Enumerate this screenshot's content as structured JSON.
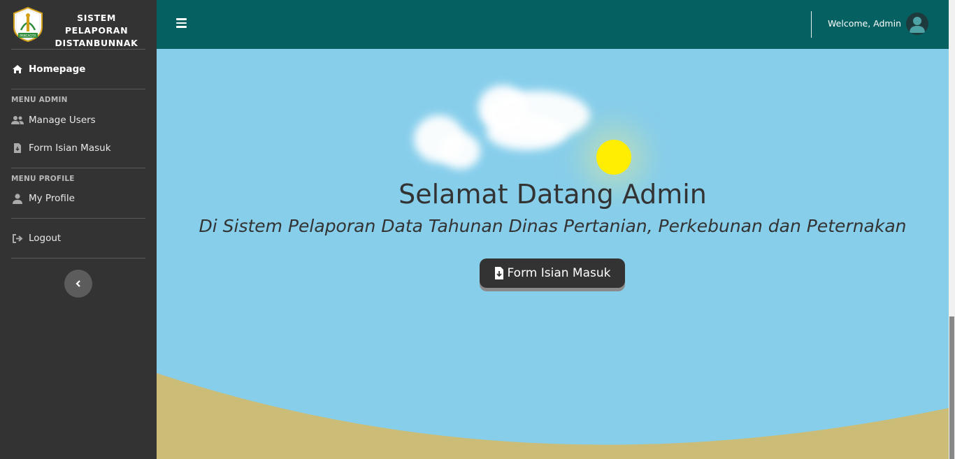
{
  "brand": {
    "line1": "SISTEM PELAPORAN",
    "line2": "DISTANBUNNAK",
    "logo_text": "PANCACITA"
  },
  "sidebar": {
    "homepage": "Homepage",
    "section_admin": "MENU ADMIN",
    "manage_users": "Manage Users",
    "form_isian": "Form Isian Masuk",
    "section_profile": "MENU PROFILE",
    "my_profile": "My Profile",
    "logout": "Logout",
    "icons": {
      "homepage": "home-icon",
      "manage_users": "users-icon",
      "form_isian": "file-download-icon",
      "my_profile": "user-icon",
      "logout": "sign-out-icon",
      "toggle": "chevron-left-icon"
    }
  },
  "topbar": {
    "welcome": "Welcome, Admin",
    "menu_icon": "bars-icon",
    "avatar_icon": "user-avatar-icon"
  },
  "hero": {
    "title": "Selamat Datang Admin",
    "subtitle": "Di Sistem Pelaporan Data Tahunan Dinas Pertanian, Perkebunan dan Peternakan",
    "button_label": "Form Isian Masuk"
  },
  "colors": {
    "sidebar_bg": "#333333",
    "topbar_bg": "#056161",
    "sky": "#87ceeb",
    "ground": "#cbbd77",
    "sun": "#ffee00",
    "button_bg": "#333333"
  }
}
